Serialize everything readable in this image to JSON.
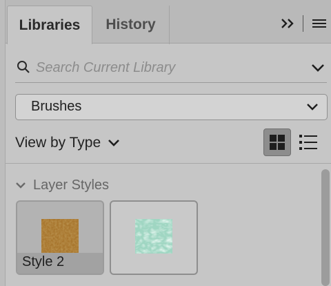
{
  "tabs": [
    {
      "label": "Libraries",
      "active": true
    },
    {
      "label": "History",
      "active": false
    }
  ],
  "icons": {
    "expand": "double-chevron-right-icon",
    "menu": "hamburger-menu-icon",
    "search": "magnifier-icon",
    "grid_view": "grid-view-icon",
    "list_view": "list-view-icon"
  },
  "search": {
    "placeholder": "Search Current Library",
    "value": ""
  },
  "library_select": {
    "selected": "Brushes"
  },
  "view_by": {
    "label": "View by Type"
  },
  "section": {
    "title": "Layer Styles",
    "expanded": true
  },
  "assets": [
    {
      "label": "Style 2",
      "selected": true,
      "swatch_color": "#9a6a2a"
    },
    {
      "label": "",
      "selected": false,
      "swatch_color": "#a9e0cf"
    }
  ],
  "colors": {
    "panel_bg": "#c6c6c6",
    "tabbar_bg": "#b9b9b9",
    "active_view_button": "#8d8d8d"
  }
}
